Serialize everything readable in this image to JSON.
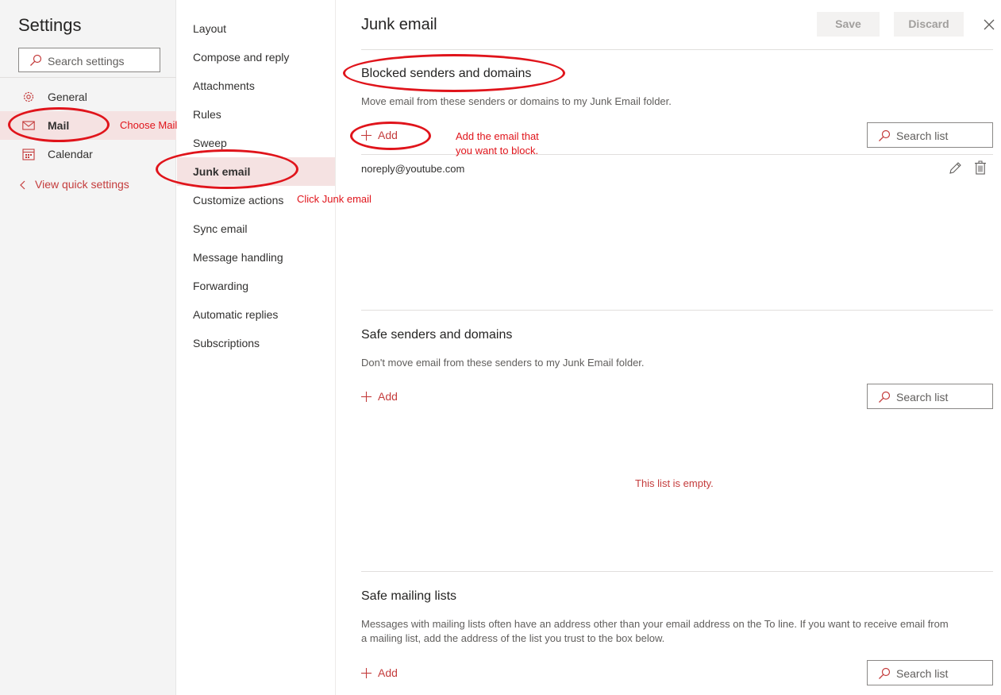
{
  "sidebar": {
    "title": "Settings",
    "search_placeholder": "Search settings",
    "items": [
      {
        "label": "General",
        "icon": "gear-icon"
      },
      {
        "label": "Mail",
        "icon": "mail-icon",
        "selected": true
      },
      {
        "label": "Calendar",
        "icon": "calendar-icon"
      }
    ],
    "quick_settings_link": "View quick settings"
  },
  "submenu": {
    "items": [
      {
        "label": "Layout"
      },
      {
        "label": "Compose and reply"
      },
      {
        "label": "Attachments"
      },
      {
        "label": "Rules"
      },
      {
        "label": "Sweep"
      },
      {
        "label": "Junk email",
        "selected": true
      },
      {
        "label": "Customize actions"
      },
      {
        "label": "Sync email"
      },
      {
        "label": "Message handling"
      },
      {
        "label": "Forwarding"
      },
      {
        "label": "Automatic replies"
      },
      {
        "label": "Subscriptions"
      }
    ]
  },
  "main": {
    "title": "Junk email",
    "save_label": "Save",
    "discard_label": "Discard",
    "sections": [
      {
        "title": "Blocked senders and domains",
        "description": "Move email from these senders or domains to my Junk Email folder.",
        "add_label": "Add",
        "search_label": "Search list",
        "entries": [
          "noreply@youtube.com"
        ]
      },
      {
        "title": "Safe senders and domains",
        "description": "Don't move email from these senders to my Junk Email folder.",
        "add_label": "Add",
        "search_label": "Search list",
        "empty_message": "This list is empty."
      },
      {
        "title": "Safe mailing lists",
        "description_line1": "Messages with mailing lists often have an address other than your email address on the To line. If you want to receive email from",
        "description_line2": "a mailing list, add the address of the list you trust to the box below.",
        "add_label": "Add",
        "search_label": "Search list"
      }
    ]
  },
  "annotations": {
    "choose_mail": "Choose Mail",
    "click_junk": "Click Junk email",
    "add_email_line1": "Add the email that",
    "add_email_line2": "you want to block."
  },
  "colors": {
    "accent": "#c43c3c",
    "selected_bg": "#f5e2e2",
    "annotation": "#e0141b"
  }
}
